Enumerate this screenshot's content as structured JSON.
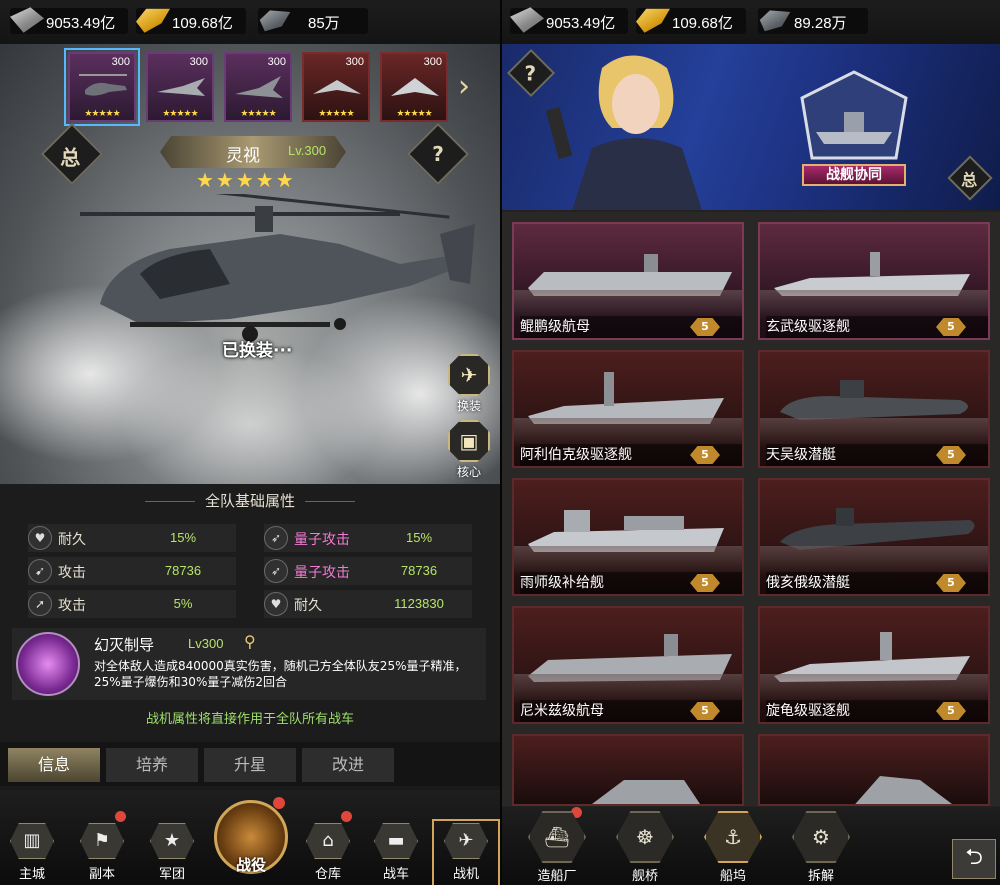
{
  "left": {
    "resources": [
      {
        "icon": "cash-stack-icon",
        "value": "9053.49亿"
      },
      {
        "icon": "gold-bar-icon",
        "value": "109.68亿"
      },
      {
        "icon": "steel-icon",
        "value": "85万"
      }
    ],
    "aircraft_cards": [
      {
        "level": "300",
        "stars": "★★★★★",
        "selected": true
      },
      {
        "level": "300",
        "stars": "★★★★★"
      },
      {
        "level": "300",
        "stars": "★★★★★"
      },
      {
        "level": "300",
        "stars": "★★★★★"
      },
      {
        "level": "300",
        "stars": "★★★★★"
      }
    ],
    "overview_btn": "总",
    "help_btn": "?",
    "aircraft_name": "灵视",
    "aircraft_level": "Lv.300",
    "aircraft_stars": "★★★★★",
    "equipped_text": "已换装···",
    "swap_label": "换装",
    "core_label": "核心",
    "attr_title": "全队基础属性",
    "attributes": [
      {
        "name": "耐久",
        "value": "15%",
        "pink": false
      },
      {
        "name": "量子攻击",
        "value": "15%",
        "pink": true
      },
      {
        "name": "攻击",
        "value": "78736",
        "pink": false
      },
      {
        "name": "量子攻击",
        "value": "78736",
        "pink": true
      },
      {
        "name": "攻击",
        "value": "5%",
        "pink": false
      },
      {
        "name": "耐久",
        "value": "1123830",
        "pink": false
      }
    ],
    "skill": {
      "name": "幻灭制导",
      "level": "Lv300",
      "desc": "对全体敌人造成840000真实伤害，随机己方全体队友25%量子精准，25%量子爆伤和30%量子减伤2回合"
    },
    "attr_note": "战机属性将直接作用于全队所有战车",
    "tabs": [
      "信息",
      "培养",
      "升星",
      "改进"
    ],
    "nav": [
      {
        "label": "主城",
        "icon": "city-icon",
        "dot": false
      },
      {
        "label": "副本",
        "icon": "flag-icon",
        "dot": true
      },
      {
        "label": "军团",
        "icon": "star-emblem-icon",
        "dot": false
      },
      {
        "label": "仓库",
        "icon": "warehouse-icon",
        "dot": true
      },
      {
        "label": "战车",
        "icon": "tank-icon",
        "dot": false
      },
      {
        "label": "战机",
        "icon": "plane-icon",
        "dot": false
      }
    ],
    "nav_main_label": "战役"
  },
  "right": {
    "resources": [
      {
        "icon": "cash-stack-icon",
        "value": "9053.49亿"
      },
      {
        "icon": "gold-bar-icon",
        "value": "109.68亿"
      },
      {
        "icon": "steel-icon",
        "value": "89.28万"
      }
    ],
    "help_btn": "?",
    "overview_btn": "总",
    "banner_title": "战舰协同",
    "ships": [
      {
        "name": "鲲鹏级航母",
        "stars": "5"
      },
      {
        "name": "玄武级驱逐舰",
        "stars": "5"
      },
      {
        "name": "阿利伯克级驱逐舰",
        "stars": "5"
      },
      {
        "name": "天吴级潜艇",
        "stars": "5"
      },
      {
        "name": "雨师级补给舰",
        "stars": "5"
      },
      {
        "name": "俄亥俄级潜艇",
        "stars": "5"
      },
      {
        "name": "尼米兹级航母",
        "stars": "5"
      },
      {
        "name": "旋龟级驱逐舰",
        "stars": "5"
      }
    ],
    "nav": [
      {
        "label": "造船厂",
        "icon": "shipyard-icon",
        "dot": true
      },
      {
        "label": "舰桥",
        "icon": "helm-icon",
        "dot": false
      },
      {
        "label": "船坞",
        "icon": "anchor-icon",
        "dot": false
      },
      {
        "label": "拆解",
        "icon": "gear-icon",
        "dot": false
      }
    ],
    "back_btn": "⮌"
  },
  "colors": {
    "accent_gold": "#d2a65a",
    "value_green": "#b7e36a",
    "quantum_pink": "#f07bd3",
    "badge_red": "#e0463a"
  }
}
